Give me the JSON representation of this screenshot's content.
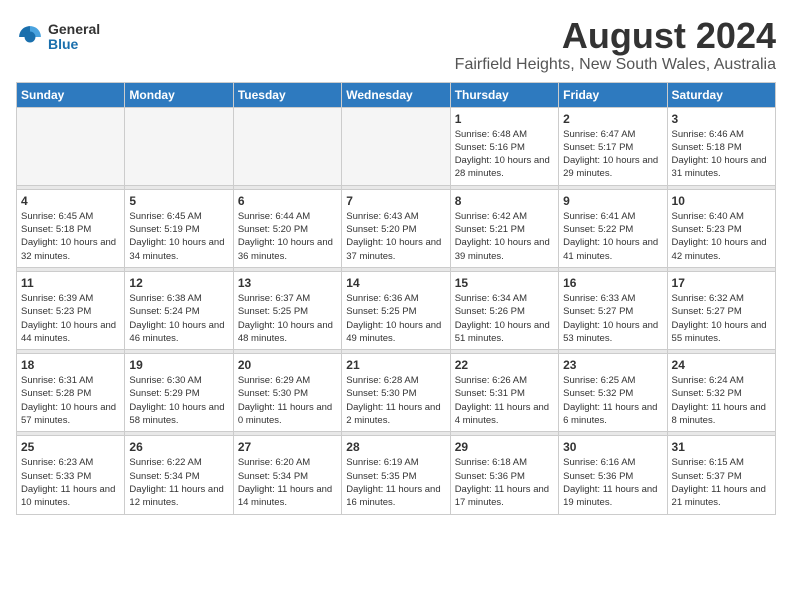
{
  "header": {
    "logo_general": "General",
    "logo_blue": "Blue",
    "title": "August 2024",
    "subtitle": "Fairfield Heights, New South Wales, Australia"
  },
  "weekdays": [
    "Sunday",
    "Monday",
    "Tuesday",
    "Wednesday",
    "Thursday",
    "Friday",
    "Saturday"
  ],
  "weeks": [
    [
      {
        "day": "",
        "empty": true
      },
      {
        "day": "",
        "empty": true
      },
      {
        "day": "",
        "empty": true
      },
      {
        "day": "",
        "empty": true
      },
      {
        "day": "1",
        "sunrise": "6:48 AM",
        "sunset": "5:16 PM",
        "daylight": "10 hours and 28 minutes."
      },
      {
        "day": "2",
        "sunrise": "6:47 AM",
        "sunset": "5:17 PM",
        "daylight": "10 hours and 29 minutes."
      },
      {
        "day": "3",
        "sunrise": "6:46 AM",
        "sunset": "5:18 PM",
        "daylight": "10 hours and 31 minutes."
      }
    ],
    [
      {
        "day": "4",
        "sunrise": "6:45 AM",
        "sunset": "5:18 PM",
        "daylight": "10 hours and 32 minutes."
      },
      {
        "day": "5",
        "sunrise": "6:45 AM",
        "sunset": "5:19 PM",
        "daylight": "10 hours and 34 minutes."
      },
      {
        "day": "6",
        "sunrise": "6:44 AM",
        "sunset": "5:20 PM",
        "daylight": "10 hours and 36 minutes."
      },
      {
        "day": "7",
        "sunrise": "6:43 AM",
        "sunset": "5:20 PM",
        "daylight": "10 hours and 37 minutes."
      },
      {
        "day": "8",
        "sunrise": "6:42 AM",
        "sunset": "5:21 PM",
        "daylight": "10 hours and 39 minutes."
      },
      {
        "day": "9",
        "sunrise": "6:41 AM",
        "sunset": "5:22 PM",
        "daylight": "10 hours and 41 minutes."
      },
      {
        "day": "10",
        "sunrise": "6:40 AM",
        "sunset": "5:23 PM",
        "daylight": "10 hours and 42 minutes."
      }
    ],
    [
      {
        "day": "11",
        "sunrise": "6:39 AM",
        "sunset": "5:23 PM",
        "daylight": "10 hours and 44 minutes."
      },
      {
        "day": "12",
        "sunrise": "6:38 AM",
        "sunset": "5:24 PM",
        "daylight": "10 hours and 46 minutes."
      },
      {
        "day": "13",
        "sunrise": "6:37 AM",
        "sunset": "5:25 PM",
        "daylight": "10 hours and 48 minutes."
      },
      {
        "day": "14",
        "sunrise": "6:36 AM",
        "sunset": "5:25 PM",
        "daylight": "10 hours and 49 minutes."
      },
      {
        "day": "15",
        "sunrise": "6:34 AM",
        "sunset": "5:26 PM",
        "daylight": "10 hours and 51 minutes."
      },
      {
        "day": "16",
        "sunrise": "6:33 AM",
        "sunset": "5:27 PM",
        "daylight": "10 hours and 53 minutes."
      },
      {
        "day": "17",
        "sunrise": "6:32 AM",
        "sunset": "5:27 PM",
        "daylight": "10 hours and 55 minutes."
      }
    ],
    [
      {
        "day": "18",
        "sunrise": "6:31 AM",
        "sunset": "5:28 PM",
        "daylight": "10 hours and 57 minutes."
      },
      {
        "day": "19",
        "sunrise": "6:30 AM",
        "sunset": "5:29 PM",
        "daylight": "10 hours and 58 minutes."
      },
      {
        "day": "20",
        "sunrise": "6:29 AM",
        "sunset": "5:30 PM",
        "daylight": "11 hours and 0 minutes."
      },
      {
        "day": "21",
        "sunrise": "6:28 AM",
        "sunset": "5:30 PM",
        "daylight": "11 hours and 2 minutes."
      },
      {
        "day": "22",
        "sunrise": "6:26 AM",
        "sunset": "5:31 PM",
        "daylight": "11 hours and 4 minutes."
      },
      {
        "day": "23",
        "sunrise": "6:25 AM",
        "sunset": "5:32 PM",
        "daylight": "11 hours and 6 minutes."
      },
      {
        "day": "24",
        "sunrise": "6:24 AM",
        "sunset": "5:32 PM",
        "daylight": "11 hours and 8 minutes."
      }
    ],
    [
      {
        "day": "25",
        "sunrise": "6:23 AM",
        "sunset": "5:33 PM",
        "daylight": "11 hours and 10 minutes."
      },
      {
        "day": "26",
        "sunrise": "6:22 AM",
        "sunset": "5:34 PM",
        "daylight": "11 hours and 12 minutes."
      },
      {
        "day": "27",
        "sunrise": "6:20 AM",
        "sunset": "5:34 PM",
        "daylight": "11 hours and 14 minutes."
      },
      {
        "day": "28",
        "sunrise": "6:19 AM",
        "sunset": "5:35 PM",
        "daylight": "11 hours and 16 minutes."
      },
      {
        "day": "29",
        "sunrise": "6:18 AM",
        "sunset": "5:36 PM",
        "daylight": "11 hours and 17 minutes."
      },
      {
        "day": "30",
        "sunrise": "6:16 AM",
        "sunset": "5:36 PM",
        "daylight": "11 hours and 19 minutes."
      },
      {
        "day": "31",
        "sunrise": "6:15 AM",
        "sunset": "5:37 PM",
        "daylight": "11 hours and 21 minutes."
      }
    ]
  ],
  "labels": {
    "sunrise": "Sunrise:",
    "sunset": "Sunset:",
    "daylight": "Daylight:"
  }
}
